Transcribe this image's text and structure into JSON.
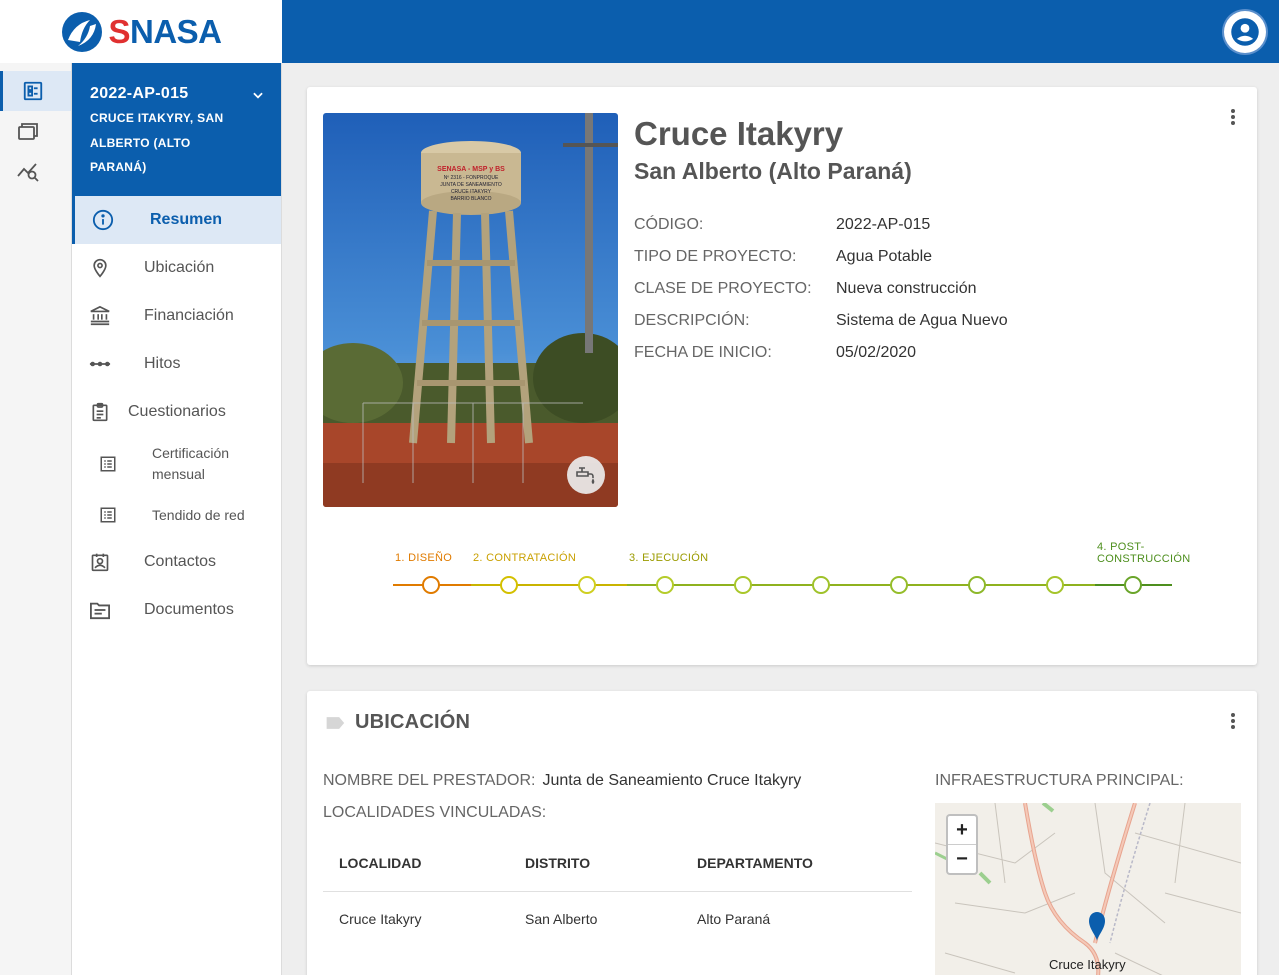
{
  "brand": {
    "logo_text_s": "S",
    "logo_text_rest": "NASA",
    "logo_accent": "#e03030",
    "primary": "#0b5ead"
  },
  "rail": [
    "dashboard-icon",
    "portfolio-icon",
    "analytics-search-icon"
  ],
  "project": {
    "code": "2022-AP-015",
    "name": "CRUCE ITAKYRY, SAN ALBERTO (ALTO PARANÁ)"
  },
  "nav": {
    "resumen": "Resumen",
    "ubicacion": "Ubicación",
    "financiacion": "Financiación",
    "hitos": "Hitos",
    "cuestionarios": "Cuestionarios",
    "certificacion": "Certificación mensual",
    "tendido": "Tendido de red",
    "contactos": "Contactos",
    "documentos": "Documentos"
  },
  "summary": {
    "title": "Cruce Itakyry",
    "subtitle": "San Alberto (Alto Paraná)",
    "photo_sign": [
      "SENASA - MSP y BS",
      "Nº 2316 - FONPROQUE",
      "JUNTA DE SANEAMIENTO",
      "CRUCE ITAKYRY",
      "BARRIO BLANCO"
    ],
    "fields": [
      {
        "label": "CÓDIGO:",
        "value": "2022-AP-015"
      },
      {
        "label": "TIPO DE PROYECTO:",
        "value": "Agua Potable"
      },
      {
        "label": "CLASE DE PROYECTO:",
        "value": "Nueva construcción"
      },
      {
        "label": "DESCRIPCIÓN:",
        "value": "Sistema de Agua Nuevo"
      },
      {
        "label": "FECHA DE INICIO:",
        "value": "05/02/2020"
      }
    ]
  },
  "timeline": {
    "stages": [
      {
        "label": "1. DISEÑO",
        "color": "#e07b00"
      },
      {
        "label": "2. CONTRATACIÓN",
        "color": "#c9a000"
      },
      {
        "label": "3. EJECUCIÓN",
        "color": "#9b9b00"
      },
      {
        "label_line1": "4. POST-",
        "label_line2": "CONSTRUCCIÓN",
        "color": "#4e8f1e"
      }
    ],
    "milestones": 10,
    "current": 1
  },
  "ubicacion": {
    "section_title": "UBICACIÓN",
    "prestador_label": "NOMBRE DEL PRESTADOR:",
    "prestador_value": "Junta de Saneamiento Cruce Itakyry",
    "localidades_label": "LOCALIDADES VINCULADAS:",
    "columns": [
      "LOCALIDAD",
      "DISTRITO",
      "DEPARTAMENTO"
    ],
    "rows": [
      [
        "Cruce Itakyry",
        "San Alberto",
        "Alto Paraná"
      ]
    ],
    "infra_label": "INFRAESTRUCTURA PRINCIPAL:",
    "map_place": "Cruce Itakyry",
    "zoom_in": "+",
    "zoom_out": "−"
  }
}
